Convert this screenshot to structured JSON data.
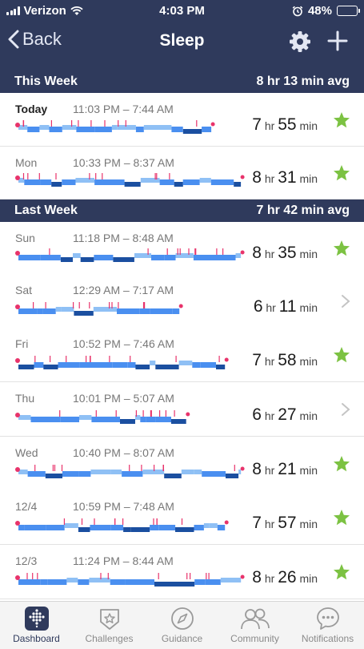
{
  "status": {
    "carrier": "Verizon",
    "time": "4:03 PM",
    "battery": "48%",
    "battery_level": 0.48
  },
  "nav": {
    "back_label": "Back",
    "title": "Sleep"
  },
  "this_week": {
    "label": "This Week",
    "avg": "8 hr 13 min avg",
    "rows": [
      {
        "day": "Today",
        "range": "11:03 PM – 7:44 AM",
        "hours": "7",
        "mins": "55",
        "goal_met": true
      },
      {
        "day": "Mon",
        "range": "10:33 PM – 8:37 AM",
        "hours": "8",
        "mins": "31",
        "goal_met": true
      }
    ]
  },
  "last_week": {
    "label": "Last Week",
    "avg": "7 hr 42 min avg",
    "rows": [
      {
        "day": "Sun",
        "range": "11:18 PM – 8:48 AM",
        "hours": "8",
        "mins": "35",
        "goal_met": true
      },
      {
        "day": "Sat",
        "range": "12:29 AM – 7:17 AM",
        "hours": "6",
        "mins": "11",
        "goal_met": false
      },
      {
        "day": "Fri",
        "range": "10:52 PM – 7:46 AM",
        "hours": "7",
        "mins": "58",
        "goal_met": true
      },
      {
        "day": "Thu",
        "range": "10:01 PM – 5:07 AM",
        "hours": "6",
        "mins": "27",
        "goal_met": false
      },
      {
        "day": "Wed",
        "range": "10:40 PM – 8:07 AM",
        "hours": "8",
        "mins": "21",
        "goal_met": true
      },
      {
        "day": "12/4",
        "range": "10:59 PM – 7:48 AM",
        "hours": "7",
        "mins": "57",
        "goal_met": true
      },
      {
        "day": "12/3",
        "range": "11:24 PM – 8:44 AM",
        "hours": "8",
        "mins": "26",
        "goal_met": true
      }
    ]
  },
  "units": {
    "hr": "hr",
    "min": "min"
  },
  "tabs": [
    {
      "label": "Dashboard",
      "icon": "dashboard-icon",
      "active": true
    },
    {
      "label": "Challenges",
      "icon": "challenges-star-icon",
      "active": false
    },
    {
      "label": "Guidance",
      "icon": "compass-icon",
      "active": false
    },
    {
      "label": "Community",
      "icon": "community-icon",
      "active": false
    },
    {
      "label": "Notifications",
      "icon": "chat-icon",
      "active": false
    }
  ],
  "colors": {
    "header_bg": "#2f3a5c",
    "goal_star": "#7cc242",
    "stage_deep": "#1b4fa0",
    "stage_light": "#4a8ff0",
    "stage_rem": "#8fc0f5",
    "stage_awake": "#e8336b"
  }
}
